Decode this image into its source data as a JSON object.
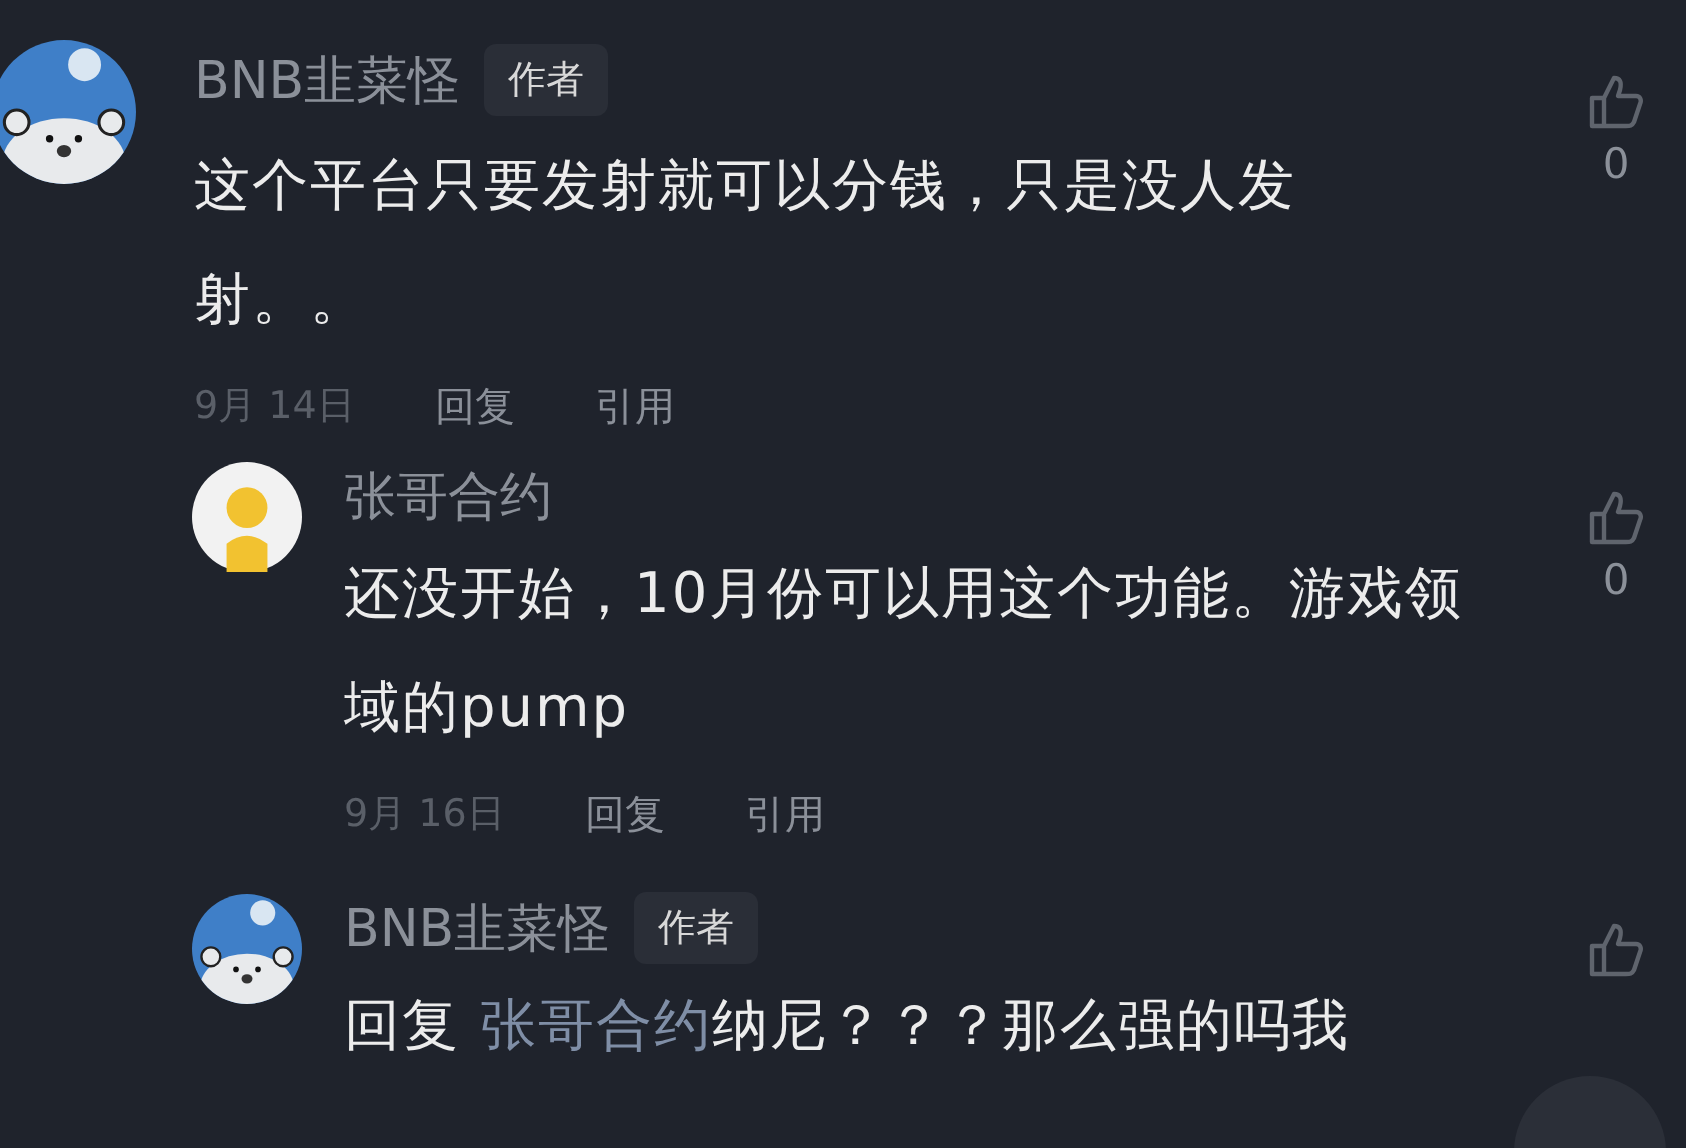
{
  "comments": [
    {
      "kind": "bear",
      "author": "BNB韭菜怪",
      "badge": "作者",
      "text": "这个平台只要发射就可以分钱，只是没人发射。。",
      "date": "9月 14日",
      "actions": [
        "回复",
        "引用"
      ],
      "likes": "0",
      "children": [
        {
          "kind": "person",
          "author": "张哥合约",
          "text": "还没开始，10月份可以用这个功能。游戏领域的pump",
          "date": "9月 16日",
          "actions": [
            "回复",
            "引用"
          ],
          "likes": "0"
        },
        {
          "kind": "bear",
          "author": "BNB韭菜怪",
          "badge": "作者",
          "reply_prefix": "回复",
          "reply_to": "张哥合约",
          "text": "纳尼？？？那么强的吗我"
        }
      ]
    }
  ]
}
